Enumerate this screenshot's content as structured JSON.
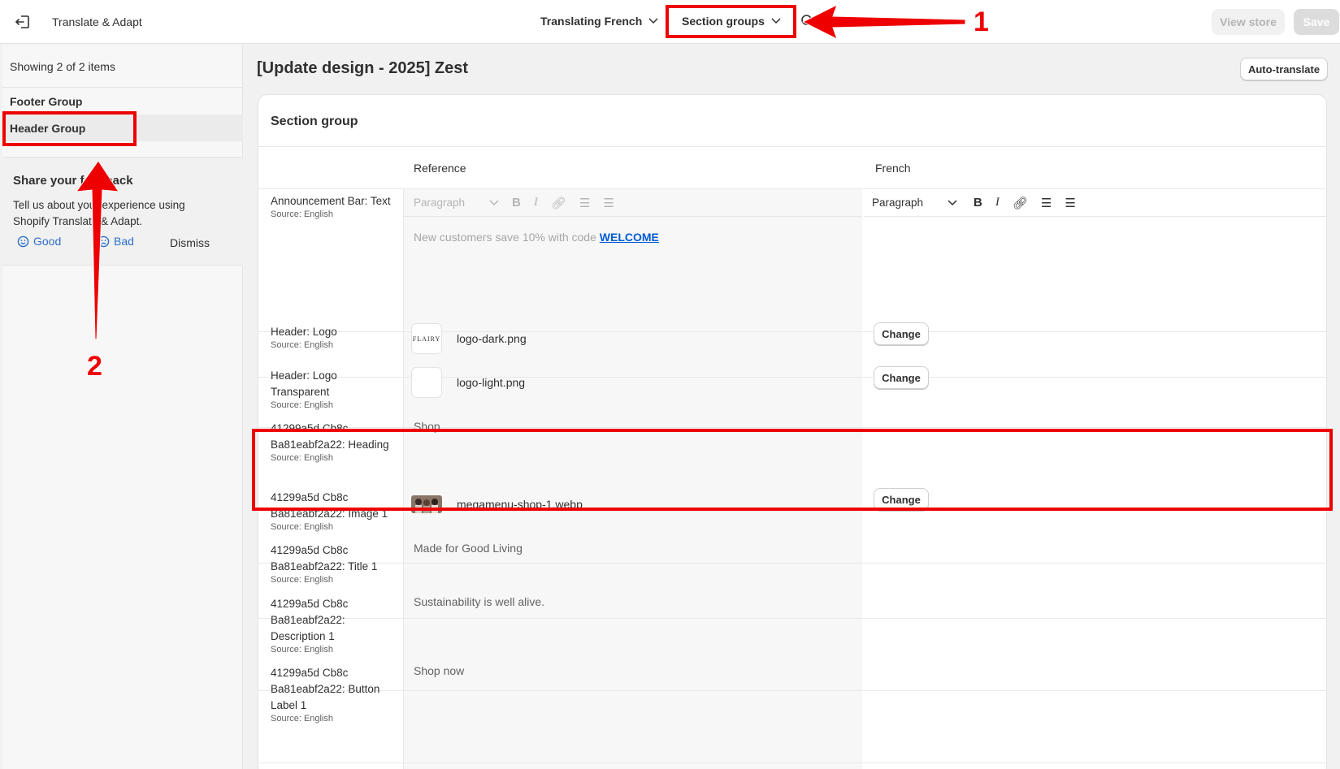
{
  "topbar": {
    "app_title": "Translate & Adapt",
    "language_select": "Translating French",
    "resource_select": "Section groups",
    "view_store": "View store",
    "save": "Save"
  },
  "sidebar": {
    "showing": "Showing 2 of 2 items",
    "items": [
      {
        "label": "Footer Group",
        "active": false
      },
      {
        "label": "Header Group",
        "active": true
      }
    ],
    "feedback": {
      "title": "Share your feedback",
      "text": "Tell us about your experience using Shopify Translate & Adapt.",
      "good": "Good",
      "bad": "Bad",
      "dismiss": "Dismiss"
    }
  },
  "main": {
    "page_title": "[Update design - 2025] Zest",
    "auto_translate": "Auto-translate",
    "card_title": "Section group",
    "col_reference": "Reference",
    "col_french": "French",
    "toolbar_paragraph": "Paragraph",
    "announcement_prefix": "New customers save 10% with code ",
    "announcement_code": "WELCOME",
    "change_label": "Change",
    "logo_thumb_text": "FLAIRY",
    "rows": [
      {
        "label": "Announcement Bar: Text",
        "source": "Source: English"
      },
      {
        "label": "Header: Logo",
        "source": "Source: English",
        "file": "logo-dark.png"
      },
      {
        "label": "Header: Logo Transparent",
        "source": "Source: English",
        "file": "logo-light.png"
      },
      {
        "label": "41299a5d Cb8c Ba81eabf2a22: Heading",
        "source": "Source: English",
        "reference": "Shop"
      },
      {
        "label": "41299a5d Cb8c Ba81eabf2a22: Image 1",
        "source": "Source: English",
        "file": "megamenu-shop-1.webp"
      },
      {
        "label": "41299a5d Cb8c Ba81eabf2a22: Title 1",
        "source": "Source: English",
        "reference": "Made for Good Living"
      },
      {
        "label": "41299a5d Cb8c Ba81eabf2a22: Description 1",
        "source": "Source: English",
        "reference": "Sustainability is well alive."
      },
      {
        "label": "41299a5d Cb8c Ba81eabf2a22: Button Label 1",
        "source": "Source: English",
        "reference": "Shop now"
      }
    ]
  },
  "annotations": {
    "marker_1": "1",
    "marker_2": "2",
    "color": "#ee0000"
  }
}
